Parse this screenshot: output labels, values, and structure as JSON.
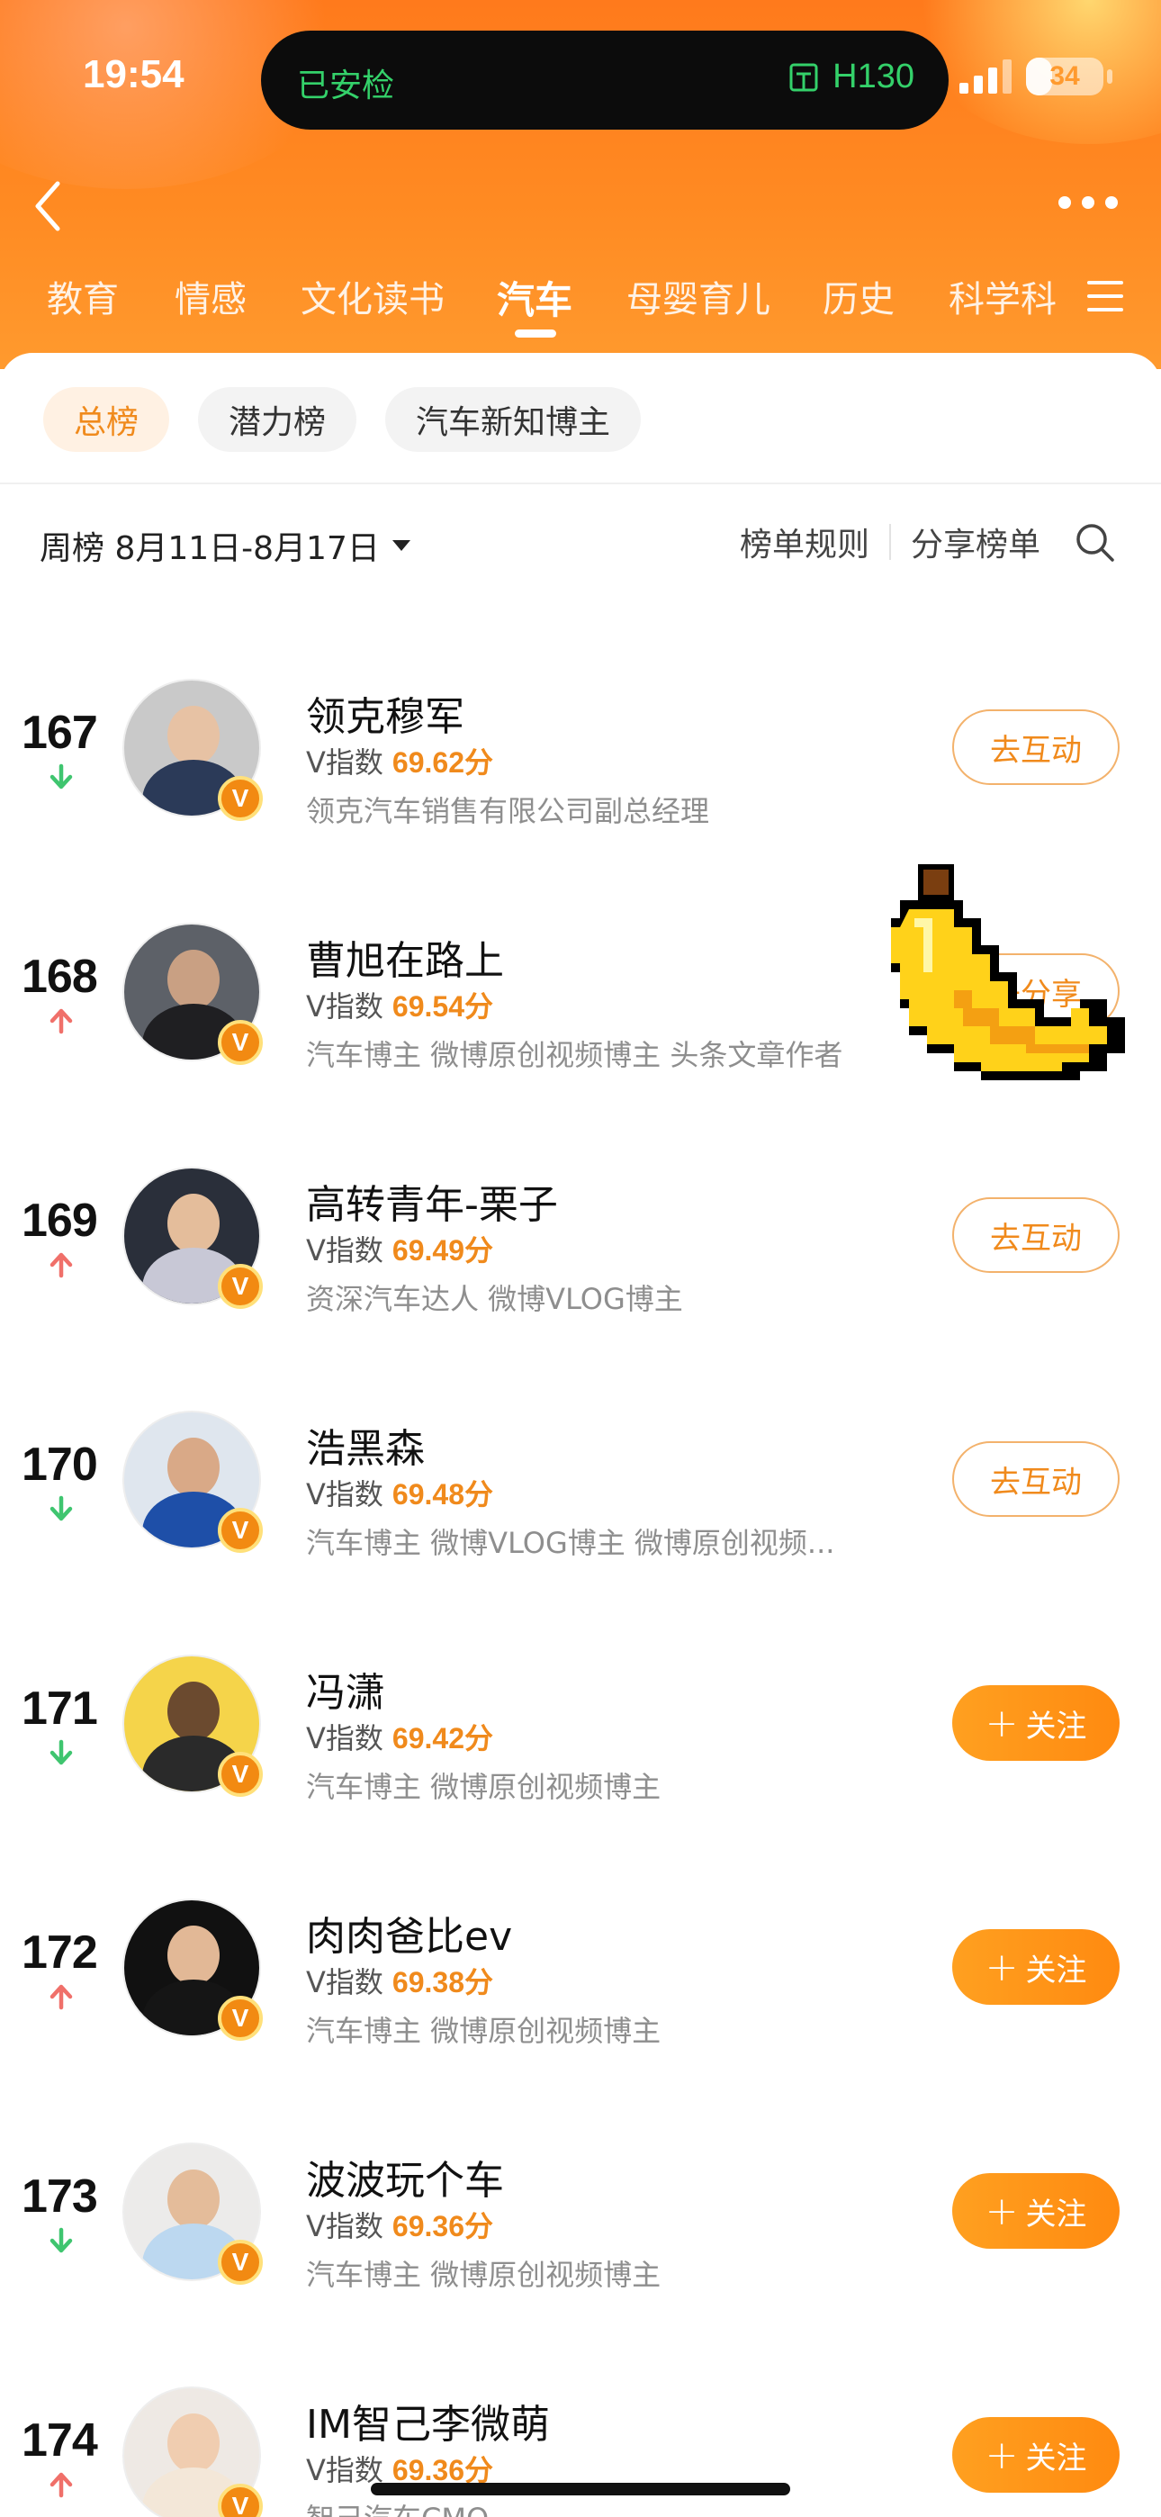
{
  "status_bar": {
    "time": "19:54",
    "island_left": "已安检",
    "island_right": "H130",
    "battery": "34",
    "battery_level_percent": 34
  },
  "nav": {
    "tabs": [
      "教育",
      "情感",
      "文化读书",
      "汽车",
      "母婴育儿",
      "历史",
      "科学科"
    ],
    "active_tab": "汽车"
  },
  "chips": [
    {
      "label": "总榜",
      "active": true
    },
    {
      "label": "潜力榜",
      "active": false
    },
    {
      "label": "汽车新知博主",
      "active": false
    }
  ],
  "period": {
    "label": "周榜 8月11日-8月17日"
  },
  "toolbar": {
    "rules": "榜单规则",
    "share": "分享榜单"
  },
  "colors": {
    "header_orange": "#ff8a22",
    "accent": "#f08a1c",
    "trend_up": "#f0706a",
    "trend_down": "#3fc56f"
  },
  "list": [
    {
      "rank": "167",
      "trend": "down",
      "name": "领克穆军",
      "index_label": "V指数",
      "score": "69.62分",
      "desc": "领克汽车销售有限公司副总经理",
      "button": "去互动",
      "button_style": "outline",
      "bg": "#c9c9c9",
      "head": "#e7c2a4",
      "body": "#2b3a58"
    },
    {
      "rank": "168",
      "trend": "up",
      "name": "曹旭在路上",
      "index_label": "V指数",
      "score": "69.54分",
      "desc": "汽车博主 微博原创视频博主 头条文章作者",
      "button": "去分享",
      "button_style": "outline",
      "bg": "#5d6168",
      "head": "#c9a083",
      "body": "#1f1f22"
    },
    {
      "rank": "169",
      "trend": "up",
      "name": "高转青年-栗子",
      "index_label": "V指数",
      "score": "69.49分",
      "desc": "资深汽车达人 微博VLOG博主",
      "button": "去互动",
      "button_style": "outline",
      "bg": "#2a2f3a",
      "head": "#e4bd9b",
      "body": "#c8c8d6"
    },
    {
      "rank": "170",
      "trend": "down",
      "name": "浩黑森",
      "index_label": "V指数",
      "score": "69.48分",
      "desc": "汽车博主 微博VLOG博主 微博原创视频...",
      "button": "去互动",
      "button_style": "outline",
      "bg": "#dfe6ee",
      "head": "#d9a987",
      "body": "#1e4fa8"
    },
    {
      "rank": "171",
      "trend": "down",
      "name": "冯潇",
      "index_label": "V指数",
      "score": "69.42分",
      "desc": "汽车博主 微博原创视频博主",
      "button": "关注",
      "button_style": "solid",
      "bg": "#f5d44a",
      "head": "#6b4a2f",
      "body": "#2a2a2a"
    },
    {
      "rank": "172",
      "trend": "up",
      "name": "肉肉爸比ev",
      "index_label": "V指数",
      "score": "69.38分",
      "desc": "汽车博主 微博原创视频博主",
      "button": "关注",
      "button_style": "solid",
      "bg": "#111111",
      "head": "#e2b896",
      "body": "#151515"
    },
    {
      "rank": "173",
      "trend": "down",
      "name": "波波玩个车",
      "index_label": "V指数",
      "score": "69.36分",
      "desc": "汽车博主 微博原创视频博主",
      "button": "关注",
      "button_style": "solid",
      "bg": "#ecebea",
      "head": "#e4bc9a",
      "body": "#bcd8f0"
    },
    {
      "rank": "174",
      "trend": "up",
      "name": "IM智己李微萌",
      "index_label": "V指数",
      "score": "69.36分",
      "desc": "智己汽车CMO",
      "button": "关注",
      "button_style": "solid",
      "bg": "#eee9e4",
      "head": "#f0cdb0",
      "body": "#f3e7d8"
    }
  ]
}
